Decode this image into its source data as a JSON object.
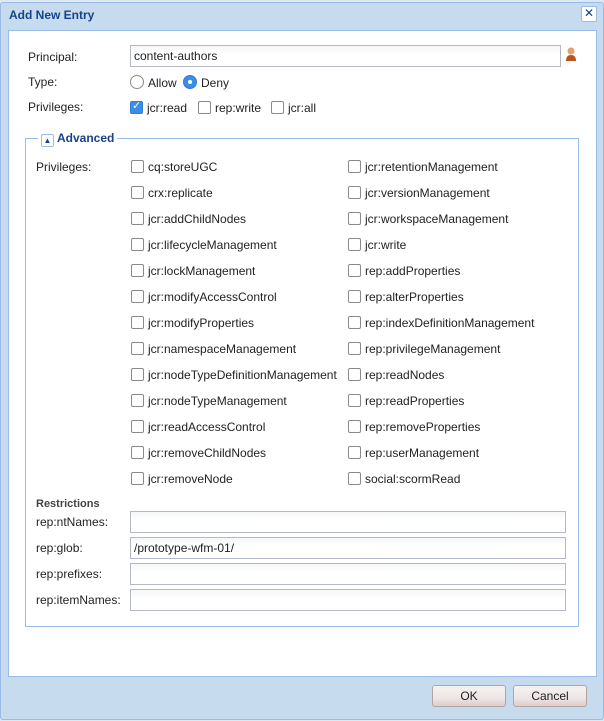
{
  "window": {
    "title": "Add New Entry",
    "close_icon": "close-icon"
  },
  "principal": {
    "label": "Principal:",
    "value": "content-authors",
    "icon": "user-icon"
  },
  "type": {
    "label": "Type:",
    "options": [
      {
        "label": "Allow",
        "selected": false
      },
      {
        "label": "Deny",
        "selected": true
      }
    ]
  },
  "privileges": {
    "label": "Privileges:",
    "options": [
      {
        "label": "jcr:read",
        "checked": true
      },
      {
        "label": "rep:write",
        "checked": false
      },
      {
        "label": "jcr:all",
        "checked": false
      }
    ]
  },
  "advanced": {
    "title": "Advanced",
    "label": "Privileges:",
    "left": [
      "cq:storeUGC",
      "crx:replicate",
      "jcr:addChildNodes",
      "jcr:lifecycleManagement",
      "jcr:lockManagement",
      "jcr:modifyAccessControl",
      "jcr:modifyProperties",
      "jcr:namespaceManagement",
      "jcr:nodeTypeDefinitionManagement",
      "jcr:nodeTypeManagement",
      "jcr:readAccessControl",
      "jcr:removeChildNodes",
      "jcr:removeNode"
    ],
    "right": [
      "jcr:retentionManagement",
      "jcr:versionManagement",
      "jcr:workspaceManagement",
      "jcr:write",
      "rep:addProperties",
      "rep:alterProperties",
      "rep:indexDefinitionManagement",
      "rep:privilegeManagement",
      "rep:readNodes",
      "rep:readProperties",
      "rep:removeProperties",
      "rep:userManagement",
      "social:scormRead"
    ]
  },
  "restrictions": {
    "title": "Restrictions",
    "fields": [
      {
        "label": "rep:ntNames:",
        "value": ""
      },
      {
        "label": "rep:glob:",
        "value": "/prototype-wfm-01/"
      },
      {
        "label": "rep:prefixes:",
        "value": ""
      },
      {
        "label": "rep:itemNames:",
        "value": ""
      }
    ]
  },
  "buttons": {
    "ok": "OK",
    "cancel": "Cancel"
  }
}
